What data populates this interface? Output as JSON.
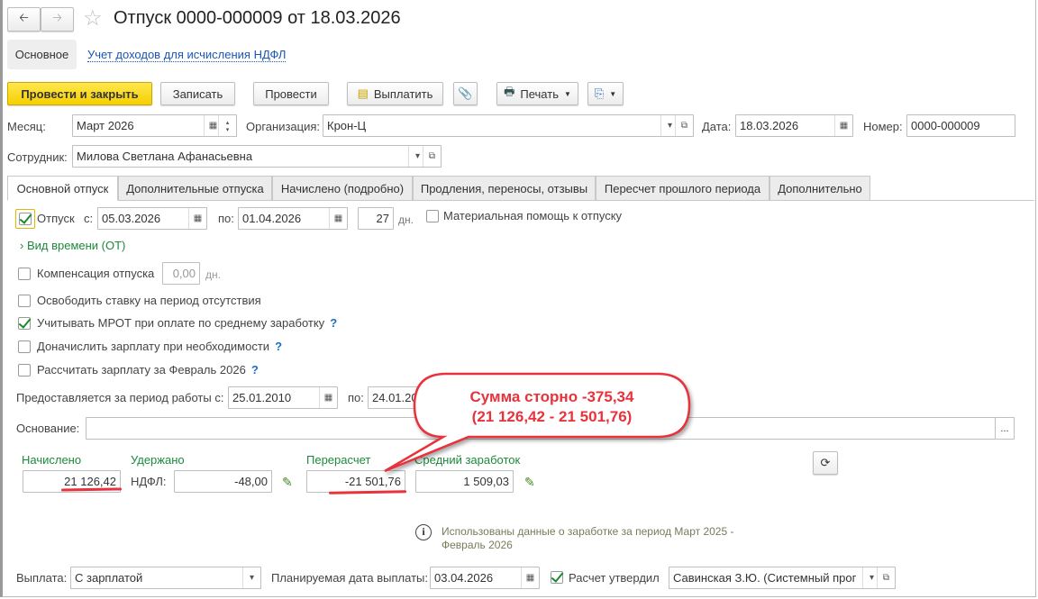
{
  "title": "Отпуск 0000-000009 от 18.03.2026",
  "sections": {
    "main": "Основное",
    "ndfl_link": "Учет доходов для исчисления НДФЛ"
  },
  "toolbar": {
    "post_close": "Провести и закрыть",
    "save": "Записать",
    "post": "Провести",
    "pay": "Выплатить",
    "print": "Печать"
  },
  "header": {
    "month_label": "Месяц:",
    "month": "Март 2026",
    "org_label": "Организация:",
    "org": "Крон-Ц",
    "date_label": "Дата:",
    "date": "18.03.2026",
    "number_label": "Номер:",
    "number": "0000-000009",
    "employee_label": "Сотрудник:",
    "employee": "Милова Светлана Афанасьевна"
  },
  "tabs": [
    "Основной отпуск",
    "Дополнительные отпуска",
    "Начислено (подробно)",
    "Продления, переносы, отзывы",
    "Пересчет прошлого периода",
    "Дополнительно"
  ],
  "vacation": {
    "label": "Отпуск",
    "from_label": "с:",
    "from": "05.03.2026",
    "to_label": "по:",
    "to": "01.04.2026",
    "days": "27",
    "days_unit": "дн.",
    "material_help": "Материальная помощь к отпуску",
    "time_kind": "Вид времени (ОТ)"
  },
  "compensation": {
    "label": "Компенсация отпуска",
    "value": "0,00",
    "unit": "дн."
  },
  "options": [
    {
      "label": "Освободить ставку на период отсутствия",
      "checked": false,
      "help": ""
    },
    {
      "label": "Учитывать МРОТ при оплате по среднему заработку",
      "checked": true,
      "help": "?"
    },
    {
      "label": "Доначислить зарплату при необходимости",
      "checked": false,
      "help": "?"
    },
    {
      "label": "Рассчитать зарплату за Февраль 2026",
      "checked": false,
      "help": "?"
    }
  ],
  "period": {
    "label": "Предоставляется за период работы с:",
    "from": "25.01.2010",
    "to_label": "по:",
    "to": "24.01.20"
  },
  "basis": {
    "label": "Основание:",
    "value": "",
    "button": "..."
  },
  "totals": {
    "accrued_label": "Начислено",
    "accrued": "21 126,42",
    "withheld_label": "Удержано",
    "ndfl_label": "НДФЛ:",
    "ndfl": "-48,00",
    "recalc_label": "Перерасчет",
    "recalc": "-21 501,76",
    "avg_label": "Средний заработок",
    "avg": "1 509,03"
  },
  "info": {
    "line1": "Использованы данные о заработке за период Март 2025 -",
    "line2": "Февраль 2026"
  },
  "payment": {
    "label": "Выплата:",
    "value": "С зарплатой",
    "planned_label": "Планируемая дата выплаты:",
    "planned": "03.04.2026",
    "approved_label": "Расчет утвердил",
    "approved": "Савинская З.Ю. (Системный прог"
  },
  "callout": {
    "line1": "Сумма сторно -375,34",
    "line2": "(21 126,42 - 21 501,76)",
    "color": "#e8323c"
  }
}
